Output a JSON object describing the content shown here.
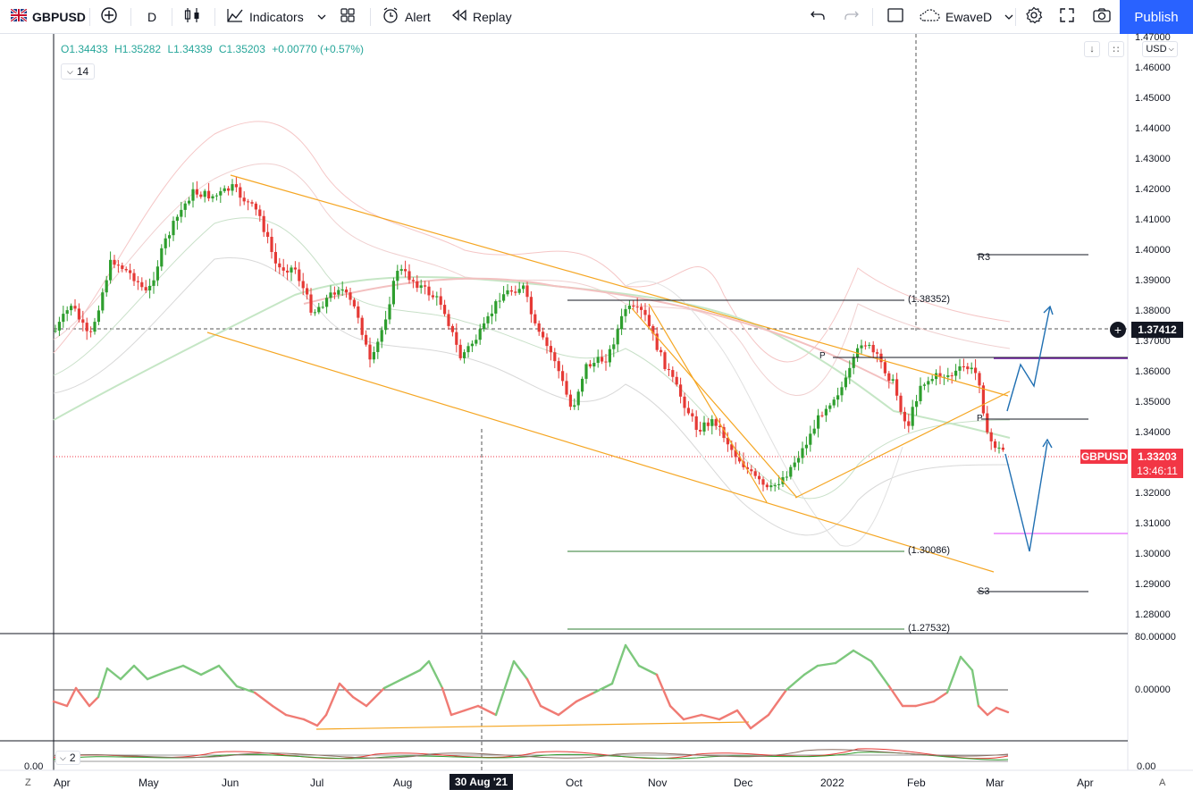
{
  "toolbar": {
    "symbol": "GBPUSD",
    "interval": "D",
    "indicators_label": "Indicators",
    "alert_label": "Alert",
    "replay_label": "Replay",
    "layout_name": "EwaveD",
    "publish_label": "Publish"
  },
  "legend": {
    "open": "O1.34433",
    "high": "H1.35282",
    "low": "L1.34339",
    "close": "C1.35203",
    "change": "+0.00770 (+0.57%)",
    "length_main": "14",
    "length_osc": "2"
  },
  "axis": {
    "currency": "USD",
    "price_ticks": [
      "1.47000",
      "1.46000",
      "1.45000",
      "1.44000",
      "1.43000",
      "1.42000",
      "1.41000",
      "1.40000",
      "1.39000",
      "1.38000",
      "1.37000",
      "1.36000",
      "1.35000",
      "1.34000",
      "1.33000",
      "1.32000",
      "1.31000",
      "1.30000",
      "1.29000",
      "1.28000"
    ],
    "osc_ticks": [
      "80.00000",
      "0.00000"
    ],
    "osc2_ticks": [
      "0.00",
      "0.00"
    ],
    "time_ticks": [
      "Apr",
      "May",
      "Jun",
      "Jul",
      "Aug",
      "30 Aug '21",
      "Oct",
      "Nov",
      "Dec",
      "2022",
      "Feb",
      "Mar",
      "Apr"
    ],
    "corner_left": "Z",
    "corner_right": "A"
  },
  "levels": {
    "fib_top": "(1.38352)",
    "fib_mid": "(1.30086)",
    "fib_low": "(1.27532)",
    "r3": "R3",
    "s3": "S3",
    "p": "P"
  },
  "price": {
    "crosshair_price": "1.37412",
    "symbol_label": "GBPUSD",
    "last_price": "1.33203",
    "countdown": "13:46:11"
  },
  "colors": {
    "up": "#26a69a",
    "up_candle": "#2e9e2e",
    "down_candle": "#e53935",
    "accent": "#2962ff",
    "trendline": "#f5a623"
  }
}
